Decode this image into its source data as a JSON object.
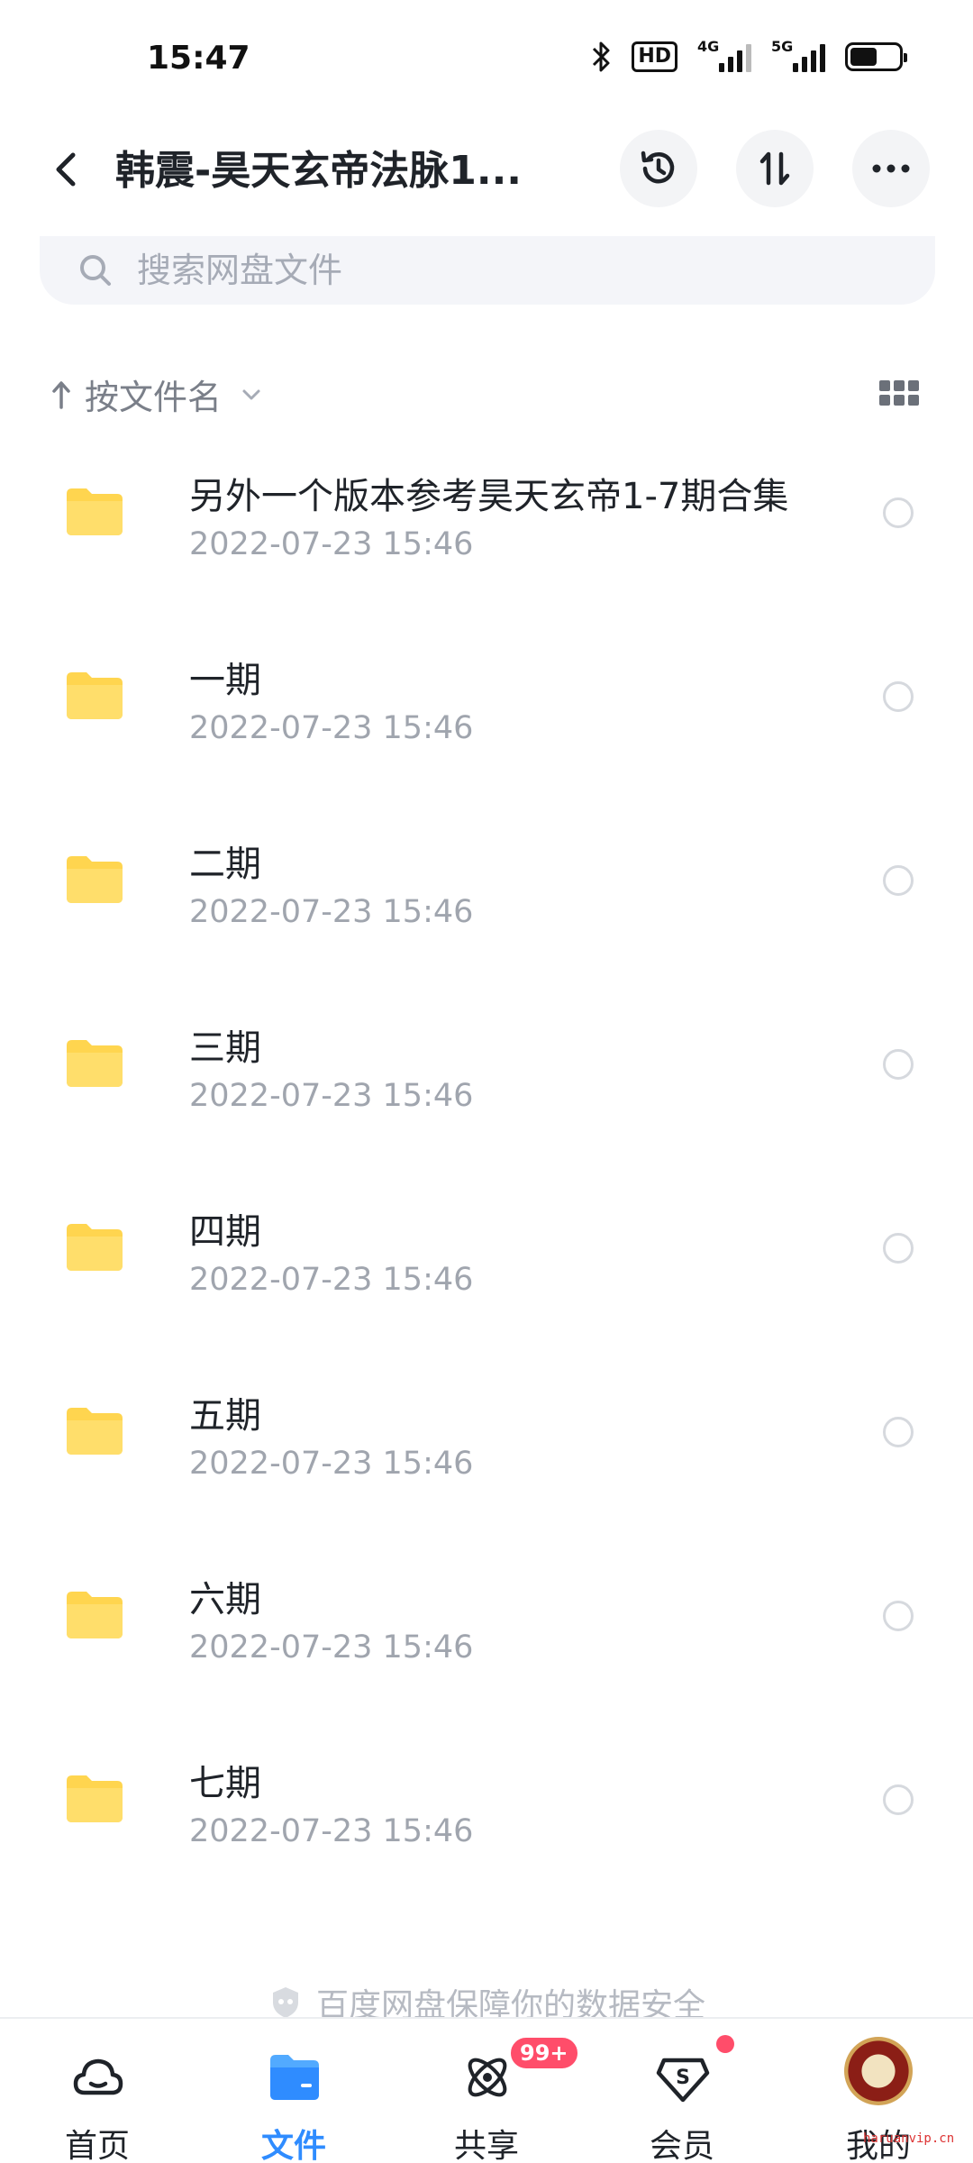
{
  "status_bar": {
    "time": "15:47",
    "hd_label": "HD",
    "network_1": "4G",
    "network_2": "5G",
    "battery_level": 0.55
  },
  "header": {
    "title": "韩震-昊天玄帝法脉1...",
    "icons": {
      "back": "back-arrow-icon",
      "history": "history-icon",
      "sort": "sort-icon",
      "more": "more-icon"
    }
  },
  "search": {
    "placeholder": "搜索网盘文件"
  },
  "sort_bar": {
    "label": "按文件名"
  },
  "files": [
    {
      "name": "另外一个版本参考昊天玄帝1-7期合集",
      "date": "2022-07-23  15:46"
    },
    {
      "name": "一期",
      "date": "2022-07-23  15:46"
    },
    {
      "name": "二期",
      "date": "2022-07-23  15:46"
    },
    {
      "name": "三期",
      "date": "2022-07-23  15:46"
    },
    {
      "name": "四期",
      "date": "2022-07-23  15:46"
    },
    {
      "name": "五期",
      "date": "2022-07-23  15:46"
    },
    {
      "name": "六期",
      "date": "2022-07-23  15:46"
    },
    {
      "name": "七期",
      "date": "2022-07-23  15:46"
    }
  ],
  "security_note": "百度网盘保障你的数据安全",
  "tabs": [
    {
      "label": "首页",
      "active": false
    },
    {
      "label": "文件",
      "active": true
    },
    {
      "label": "共享",
      "active": false,
      "badge": "99+"
    },
    {
      "label": "会员",
      "active": false,
      "dot": true
    },
    {
      "label": "我的",
      "active": false
    }
  ],
  "watermark": "haruanvip.cn",
  "colors": {
    "accent": "#2f8cff",
    "folder": "#ffd54f",
    "badge": "#ff4d6a"
  }
}
